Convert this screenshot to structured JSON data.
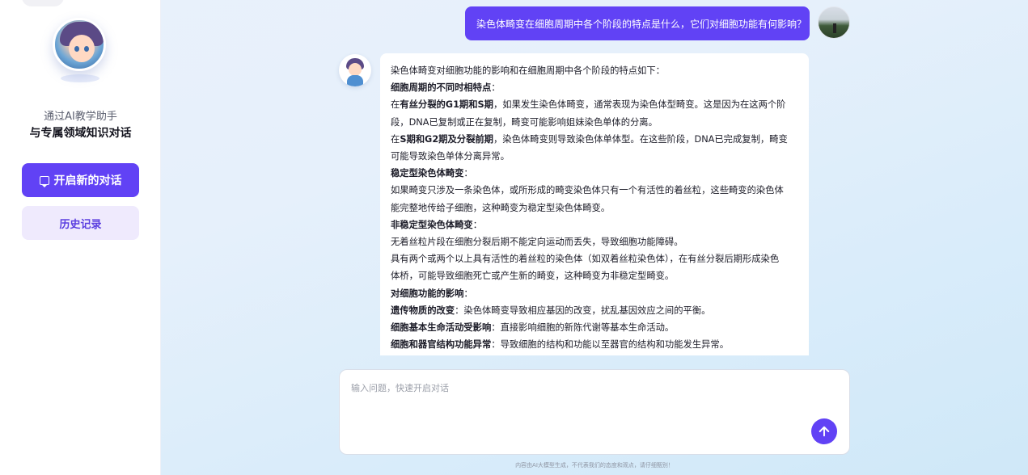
{
  "sidebar": {
    "subtitle": "通过AI教学助手",
    "title": "与专属领域知识对话",
    "new_chat_label": "开启新的对话",
    "history_label": "历史记录"
  },
  "conversation": {
    "user_message": "染色体畸变在细胞周期中各个阶段的特点是什么，它们对细胞功能有何影响？",
    "answer_lines": [
      [
        {
          "t": "染色体畸变对细胞功能的影响和在细胞周期中各个阶段的特点如下：",
          "b": false
        }
      ],
      [
        {
          "t": "细胞周期的不同时相特点",
          "b": true
        },
        {
          "t": "：",
          "b": false
        }
      ],
      [
        {
          "t": "在",
          "b": false
        },
        {
          "t": "有丝分裂的G1期和S期",
          "b": true
        },
        {
          "t": "，如果发生染色体畸变，通常表现为染色体型畸变。这是因为在这两个阶",
          "b": false
        }
      ],
      [
        {
          "t": "段，DNA已复制或正在复制，畸变可能影响姐妹染色单体的分离。",
          "b": false
        }
      ],
      [
        {
          "t": "在",
          "b": false
        },
        {
          "t": "S期和G2期及分裂前期",
          "b": true
        },
        {
          "t": "，染色体畸变则导致染色体单体型。在这些阶段，DNA已完成复制，畸变",
          "b": false
        }
      ],
      [
        {
          "t": "可能导致染色单体分离异常。",
          "b": false
        }
      ],
      [
        {
          "t": "稳定型染色体畸变",
          "b": true
        },
        {
          "t": "：",
          "b": false
        }
      ],
      [
        {
          "t": "如果畸变只涉及一条染色体，或所形成的畸变染色体只有一个有活性的着丝粒，这些畸变的染色体",
          "b": false
        }
      ],
      [
        {
          "t": "能完整地传给子细胞，这种畸变为稳定型染色体畸变。",
          "b": false
        }
      ],
      [
        {
          "t": "非稳定型染色体畸变",
          "b": true
        },
        {
          "t": "：",
          "b": false
        }
      ],
      [
        {
          "t": "无着丝粒片段在细胞分裂后期不能定向运动而丢失，导致细胞功能障碍。",
          "b": false
        }
      ],
      [
        {
          "t": "具有两个或两个以上具有活性的着丝粒的染色体（如双着丝粒染色体），在有丝分裂后期形成染色",
          "b": false
        }
      ],
      [
        {
          "t": "体桥，可能导致细胞死亡或产生新的畸变，这种畸变为非稳定型畸变。",
          "b": false
        }
      ],
      [
        {
          "t": "对细胞功能的影响",
          "b": true
        },
        {
          "t": "：",
          "b": false
        }
      ],
      [
        {
          "t": "遗传物质的改变",
          "b": true
        },
        {
          "t": "：染色体畸变导致相应基因的改变，扰乱基因效应之间的平衡。",
          "b": false
        }
      ],
      [
        {
          "t": "细胞基本生命活动受影响",
          "b": true
        },
        {
          "t": "：直接影响细胞的新陈代谢等基本生命活动。",
          "b": false
        }
      ],
      [
        {
          "t": "细胞和器官结构功能异常",
          "b": true
        },
        {
          "t": "：导致细胞的结构和功能以至器官的结构和功能发生异常。",
          "b": false
        }
      ]
    ]
  },
  "composer": {
    "placeholder": "输入问题，快速开启对话",
    "disclaimer": "内容由AI大模型生成，不代表我们的态度和观点，请仔细甄别！"
  },
  "colors": {
    "accent": "#6142f5",
    "history_bg": "#efeafd"
  },
  "icons": {
    "new_chat": "chat-bubble-icon",
    "send": "arrow-up-icon"
  }
}
